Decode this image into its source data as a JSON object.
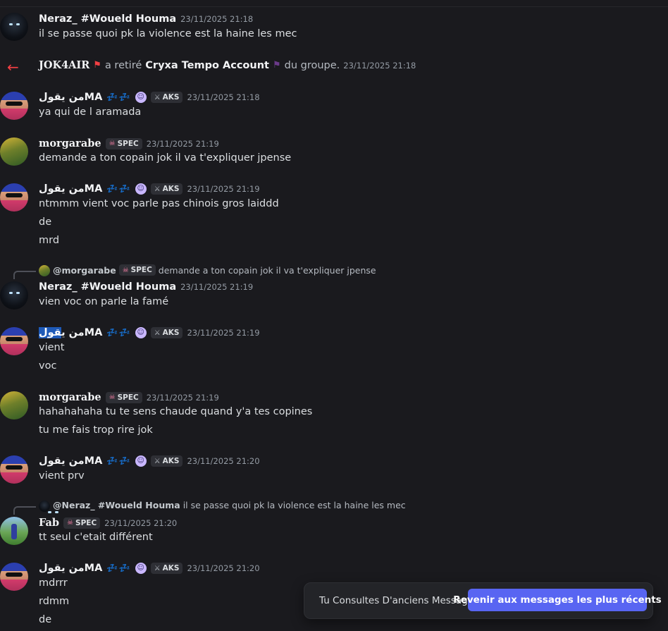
{
  "messages": [
    {
      "user": "Neraz_ #Woueld Houma",
      "time": "23/11/2025 21:18",
      "lines": [
        "il se passe quoi pk la violence est la haine les mec"
      ]
    },
    {
      "system": {
        "actor": "JOK4AIR",
        "action": "a retiré",
        "target": "Cryxa Tempo Account",
        "suffix": "du groupe.",
        "time": "23/11/2025 21:18"
      }
    },
    {
      "user": "من يقولMA",
      "badge": "AKS",
      "time": "23/11/2025 21:18",
      "lines": [
        "ya qui de l aramada"
      ]
    },
    {
      "user": "morgarabe",
      "badge": "SPEC",
      "time": "23/11/2025 21:19",
      "lines": [
        "demande a ton copain jok il va t'expliquer jpense"
      ]
    },
    {
      "user": "من يقولMA",
      "badge": "AKS",
      "time": "23/11/2025 21:19",
      "lines": [
        "ntmmm vient voc parle pas chinois gros laiddd",
        "de",
        "mrd"
      ]
    },
    {
      "reply": {
        "name": "@morgarabe",
        "badge": "SPEC",
        "text": "demande a ton copain jok il va t'expliquer jpense"
      },
      "user": "Neraz_ #Woueld Houma",
      "time": "23/11/2025 21:19",
      "lines": [
        "vien voc on parle la famé"
      ]
    },
    {
      "user_a": "من ي",
      "user_sel": "قول",
      "user_b": "MA",
      "badge": "AKS",
      "time": "23/11/2025 21:19",
      "lines": [
        "vient",
        "voc"
      ]
    },
    {
      "user": "morgarabe",
      "badge": "SPEC",
      "time": "23/11/2025 21:19",
      "lines": [
        "hahahahaha tu te sens chaude quand y'a tes copines",
        "tu me fais trop rire jok"
      ]
    },
    {
      "user": "من يقولMA",
      "badge": "AKS",
      "time": "23/11/2025 21:20",
      "lines": [
        "vient prv"
      ]
    },
    {
      "reply": {
        "name": "@Neraz_ #Woueld Houma",
        "text": "il se passe quoi pk la violence est la haine les mec"
      },
      "user": "Fab",
      "badge": "SPEC",
      "time": "23/11/2025 21:20",
      "lines": [
        "tt seul c'etait différent"
      ]
    },
    {
      "user": "من يقولMA",
      "badge": "AKS",
      "time": "23/11/2025 21:20",
      "lines": [
        "mdrrr",
        "rdmm",
        "de"
      ]
    }
  ],
  "jump_bar": {
    "text": "Tu Consultes D'anciens Messages",
    "button": "Revenir aux messages les plus récents"
  },
  "icons": {
    "system_arrow": "arrow-left-icon",
    "badge_spec": "skull-icon",
    "badge_aks": "sword-icon",
    "emoji_zzz": "zzz-icon",
    "emoji_ghost": "ghost-icon"
  },
  "colors": {
    "background": "#1a1a1e",
    "accent": "#5865f2",
    "system_arrow": "#f23f43"
  }
}
